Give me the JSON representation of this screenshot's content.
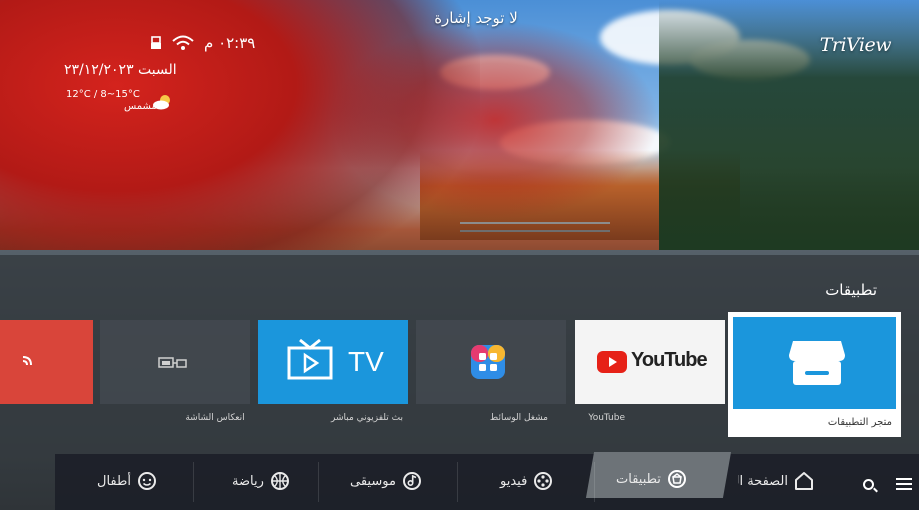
{
  "status_bar": {
    "no_signal": "لا توجد إشارة",
    "time": "٠٢:٣٩ م",
    "date": "السبت ٢٣/١٢/٢٠٢٣",
    "weather_temp": "12°C / 8~15°C",
    "weather_condition": "مشمس",
    "brand": "TriView"
  },
  "apps": {
    "section_title": "تطبيقات",
    "tiles": [
      {
        "label": "",
        "icon": "signal-icon"
      },
      {
        "label": "انعكاس الشاشة",
        "icon": "screen-cast-icon"
      },
      {
        "label": "بث تلفزيوني مباشر",
        "icon": "tv-icon",
        "text": "TV"
      },
      {
        "label": "مشغل الوسائط",
        "icon": "media-player-icon"
      },
      {
        "label": "YouTube",
        "icon": "youtube-icon",
        "text": "YouTube"
      },
      {
        "label": "متجر التطبيقات",
        "icon": "app-store-icon"
      }
    ]
  },
  "nav": {
    "items": [
      {
        "label": "أطفال",
        "icon": "kids-icon"
      },
      {
        "label": "رياضة",
        "icon": "sports-icon"
      },
      {
        "label": "موسيقى",
        "icon": "music-icon"
      },
      {
        "label": "فيديو",
        "icon": "video-icon"
      },
      {
        "label": "تطبيقات",
        "icon": "apps-icon",
        "active": true
      },
      {
        "label": "الصفحة الر",
        "icon": "home-icon"
      }
    ],
    "search_icon": "search-icon",
    "menu_icon": "menu-icon"
  },
  "colors": {
    "accent_blue": "#1b96dc",
    "youtube_red": "#e62117",
    "tile_red": "#d9453a",
    "active_nav": "#6d7378"
  }
}
